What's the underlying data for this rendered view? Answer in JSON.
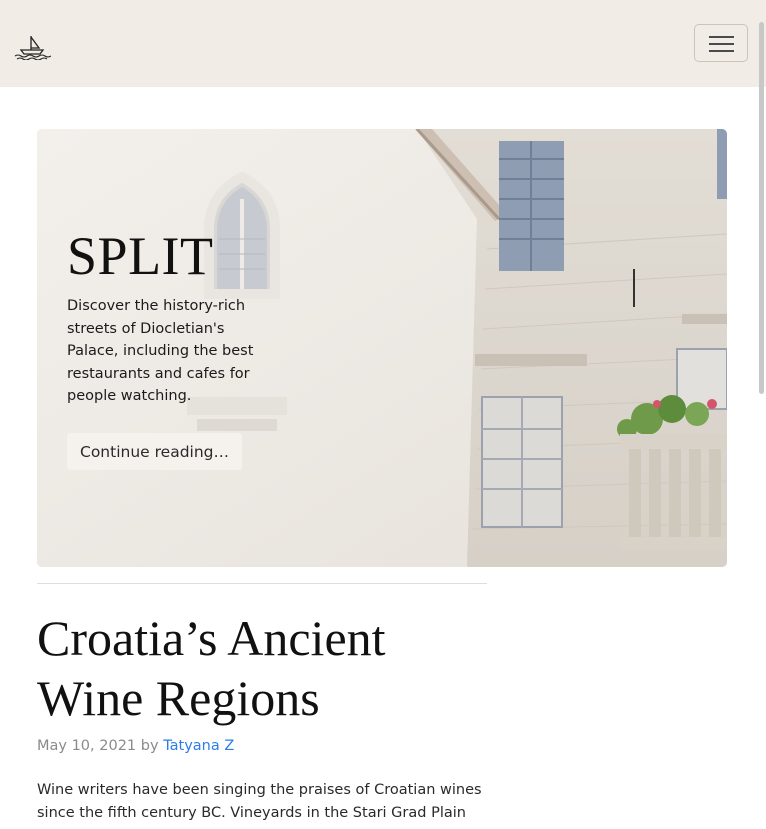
{
  "navbar": {
    "logo_icon": "sailboat-icon",
    "toggle_icon": "hamburger-menu-icon",
    "background": "#f1ede6"
  },
  "hero": {
    "title": "SPLIT",
    "description": "Discover the history-rich streets of Diocletian's Palace, including the best restaurants and cafes for people watching.",
    "button_label": "Continue reading…"
  },
  "post": {
    "title": "Croatia’s Ancient Wine Regions",
    "date": "May 10, 2021",
    "by": "by",
    "author": "Tatyana Z",
    "excerpt": "Wine writers have been singing the praises of Croatian wines since the fifth century BC. Vineyards in the Stari Grad Plain"
  },
  "colors": {
    "link": "#2b7de9",
    "meta": "#8b8b8b"
  }
}
